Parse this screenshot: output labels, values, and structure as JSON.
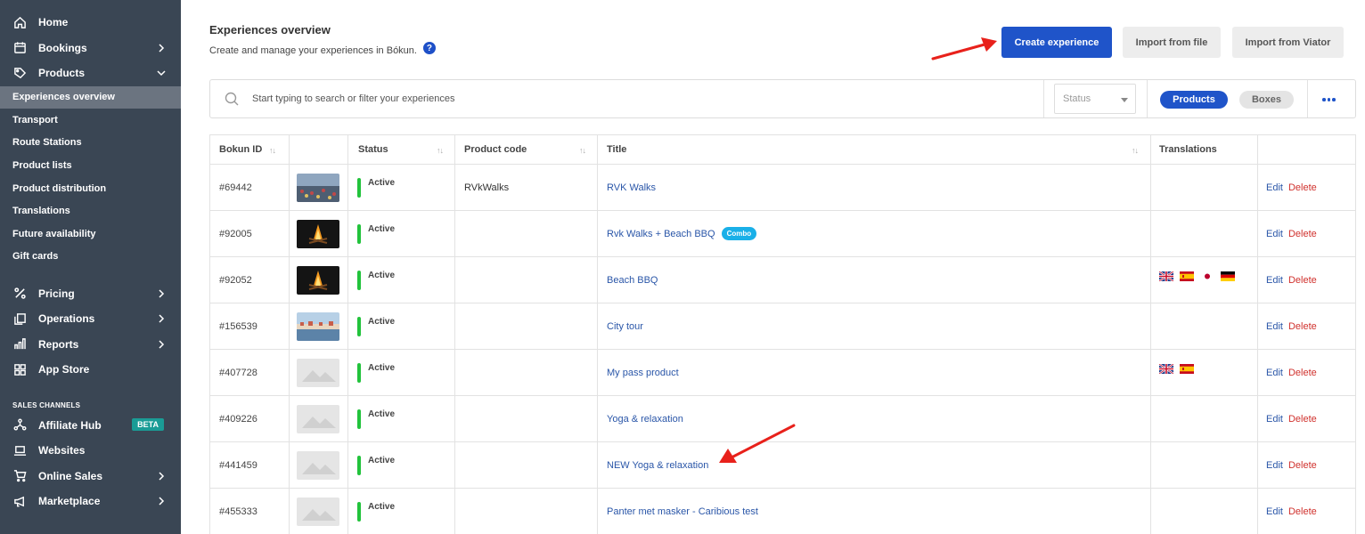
{
  "sidebar": {
    "nav_top": [
      {
        "label": "Home",
        "icon": "home-icon"
      },
      {
        "label": "Bookings",
        "icon": "calendar-icon",
        "chevron": "right"
      },
      {
        "label": "Products",
        "icon": "tag-icon",
        "chevron": "down"
      }
    ],
    "products_sub": [
      {
        "label": "Experiences overview",
        "active": true
      },
      {
        "label": "Transport"
      },
      {
        "label": "Route Stations"
      },
      {
        "label": "Product lists"
      },
      {
        "label": "Product distribution"
      },
      {
        "label": "Translations"
      },
      {
        "label": "Future availability"
      },
      {
        "label": "Gift cards"
      }
    ],
    "nav_mid": [
      {
        "label": "Pricing",
        "icon": "percent-icon"
      },
      {
        "label": "Operations",
        "icon": "copy-icon"
      },
      {
        "label": "Reports",
        "icon": "bar-chart-icon"
      },
      {
        "label": "App Store",
        "icon": "grid-icon"
      }
    ],
    "sales_channels_title": "SALES CHANNELS",
    "sales_channels": [
      {
        "label": "Affiliate Hub",
        "icon": "network-icon",
        "badge": "BETA"
      },
      {
        "label": "Websites",
        "icon": "laptop-icon"
      },
      {
        "label": "Online Sales",
        "icon": "cart-icon"
      },
      {
        "label": "Marketplace",
        "icon": "megaphone-icon"
      }
    ]
  },
  "header": {
    "title": "Experiences overview",
    "subtitle": "Create and manage your experiences in Bókun.",
    "help": "?",
    "create_label": "Create experience",
    "import_file_label": "Import from file",
    "import_viator_label": "Import from Viator"
  },
  "search": {
    "placeholder": "Start typing to search or filter your experiences",
    "status_placeholder": "Status",
    "toggle_products": "Products",
    "toggle_boxes": "Boxes"
  },
  "table": {
    "columns": {
      "id": "Bokun ID",
      "status": "Status",
      "code": "Product code",
      "title": "Title",
      "translations": "Translations"
    },
    "actions": {
      "edit": "Edit",
      "delete": "Delete"
    },
    "rows": [
      {
        "id": "#69442",
        "status": "Active",
        "code": "RVkWalks",
        "title": "RVK Walks",
        "image": "city-crowd",
        "badge": "",
        "flags": []
      },
      {
        "id": "#92005",
        "status": "Active",
        "code": "",
        "title": "Rvk Walks + Beach BBQ",
        "image": "campfire",
        "badge": "Combo",
        "flags": []
      },
      {
        "id": "#92052",
        "status": "Active",
        "code": "",
        "title": "Beach BBQ",
        "image": "campfire",
        "badge": "",
        "flags": [
          "uk",
          "es",
          "jp",
          "de"
        ]
      },
      {
        "id": "#156539",
        "status": "Active",
        "code": "",
        "title": "City tour",
        "image": "harbour",
        "badge": "",
        "flags": []
      },
      {
        "id": "#407728",
        "status": "Active",
        "code": "",
        "title": "My pass product",
        "image": "placeholder",
        "badge": "",
        "flags": [
          "uk",
          "es"
        ]
      },
      {
        "id": "#409226",
        "status": "Active",
        "code": "",
        "title": "Yoga & relaxation",
        "image": "placeholder",
        "badge": "",
        "flags": []
      },
      {
        "id": "#441459",
        "status": "Active",
        "code": "",
        "title": "NEW Yoga & relaxation",
        "image": "placeholder",
        "badge": "",
        "flags": []
      },
      {
        "id": "#455333",
        "status": "Active",
        "code": "",
        "title": "Panter met masker - Caribious test",
        "image": "placeholder",
        "badge": "",
        "flags": []
      }
    ]
  },
  "colors": {
    "sidebar_bg": "#3a4654",
    "accent": "#1f54c9",
    "active_green": "#22c33c",
    "delete_red": "#d0312d",
    "annotation_arrow": "#e8211b"
  }
}
